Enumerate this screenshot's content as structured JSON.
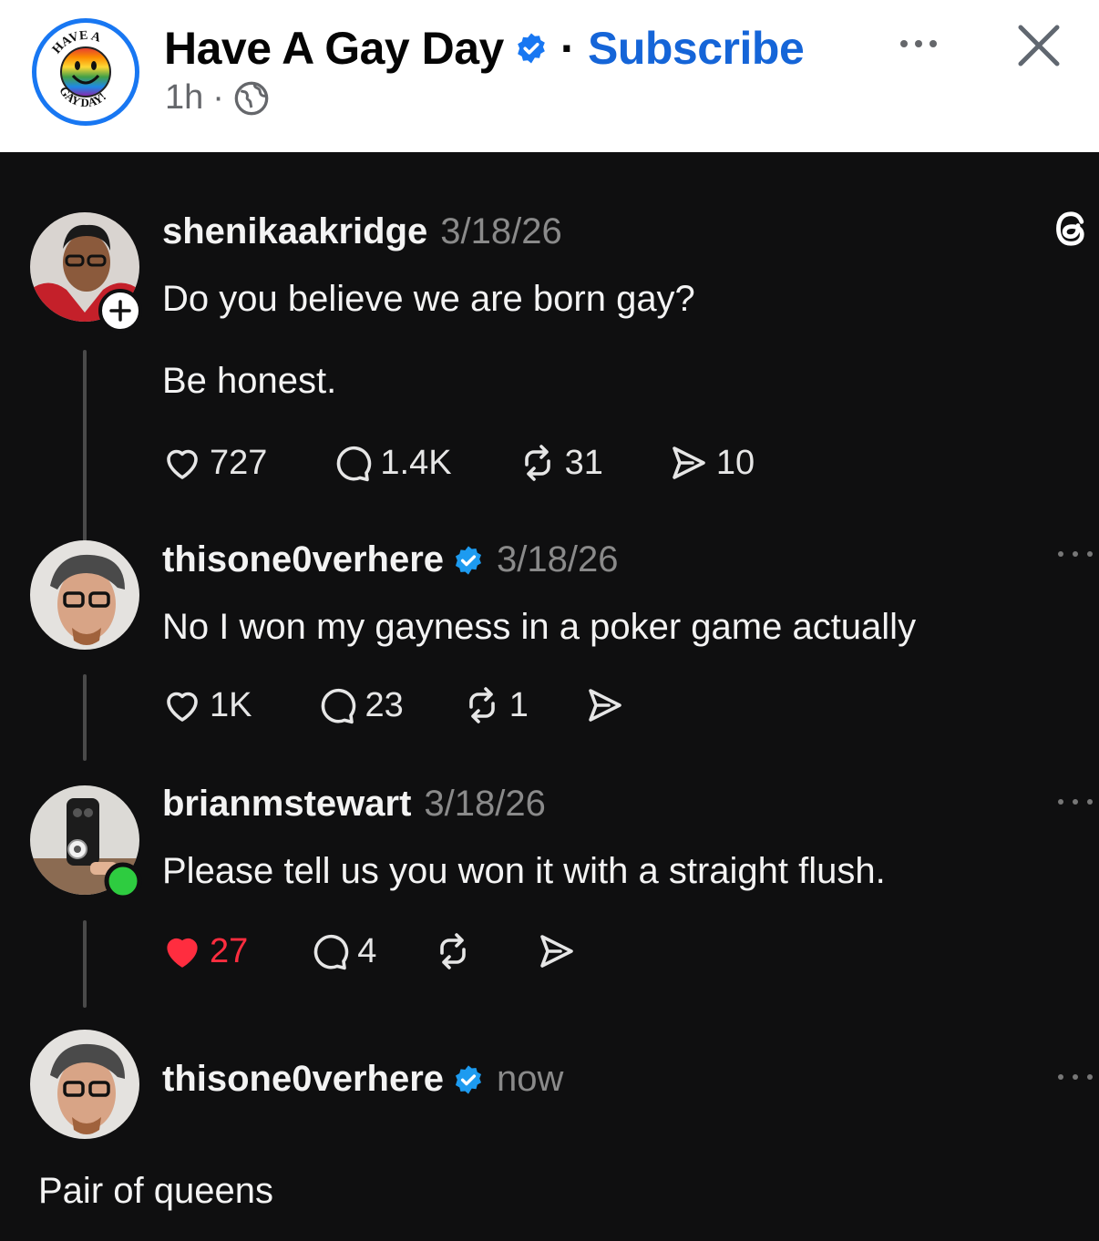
{
  "header": {
    "page_name": "Have A Gay Day",
    "separator": "·",
    "subscribe_label": "Subscribe",
    "time": "1h",
    "meta_separator": "·",
    "logo_text_top": "HAVE A",
    "logo_text_bottom": "GAY DAY!"
  },
  "posts": [
    {
      "username": "shenikaakridge",
      "date": "3/18/26",
      "lines": [
        "Do you believe we are born gay?",
        "Be honest."
      ],
      "likes": "727",
      "comments": "1.4K",
      "reposts": "31",
      "shares": "10"
    },
    {
      "username": "thisone0verhere",
      "date": "3/18/26",
      "lines": [
        "No I won my gayness in a poker game actually"
      ],
      "likes": "1K",
      "comments": "23",
      "reposts": "1",
      "shares": ""
    },
    {
      "username": "brianmstewart",
      "date": "3/18/26",
      "lines": [
        "Please tell us you won it with a straight flush."
      ],
      "likes": "27",
      "comments": "4",
      "reposts": "",
      "shares": ""
    },
    {
      "username": "thisone0verhere",
      "date": "now",
      "lines": [
        "Pair of queens"
      ]
    }
  ],
  "colors": {
    "facebook_blue": "#1877f2",
    "liked_red": "#ff2d3f",
    "verified_blue": "#1d9bf0",
    "online_green": "#2ecc40"
  }
}
